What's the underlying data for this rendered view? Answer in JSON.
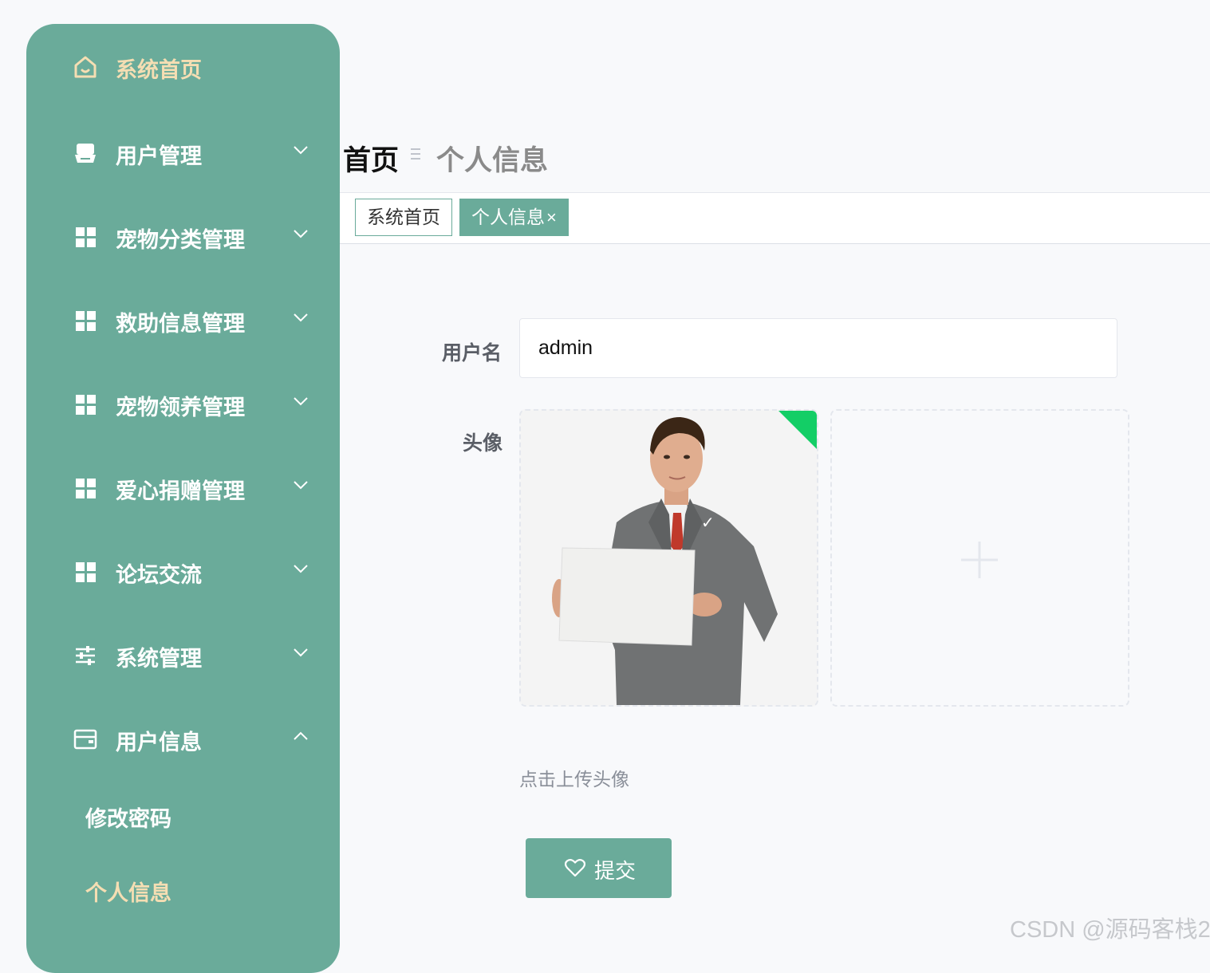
{
  "sidebar": {
    "items": [
      {
        "label": "系统首页",
        "icon": "home-icon"
      },
      {
        "label": "用户管理",
        "icon": "user-icon"
      },
      {
        "label": "宠物分类管理",
        "icon": "grid-icon"
      },
      {
        "label": "救助信息管理",
        "icon": "grid-icon"
      },
      {
        "label": "宠物领养管理",
        "icon": "grid-icon"
      },
      {
        "label": "爱心捐赠管理",
        "icon": "grid-icon"
      },
      {
        "label": "论坛交流",
        "icon": "grid-icon"
      },
      {
        "label": "系统管理",
        "icon": "sliders-icon"
      },
      {
        "label": "用户信息",
        "icon": "wallet-icon"
      }
    ],
    "submenu": [
      {
        "label": "修改密码"
      },
      {
        "label": "个人信息"
      }
    ]
  },
  "breadcrumb": {
    "home": "首页",
    "current": "个人信息"
  },
  "tabs": [
    {
      "label": "系统首页"
    },
    {
      "label": "个人信息",
      "close": "×"
    }
  ],
  "form": {
    "username_label": "用户名",
    "username_value": "admin",
    "avatar_label": "头像",
    "avatar_hint": "点击上传头像",
    "submit_label": "提交"
  },
  "watermark": "CSDN @源码客栈2",
  "colors": {
    "accent": "#6aab9a",
    "active_text": "#f5deb3",
    "success_corner": "#13ce66"
  }
}
